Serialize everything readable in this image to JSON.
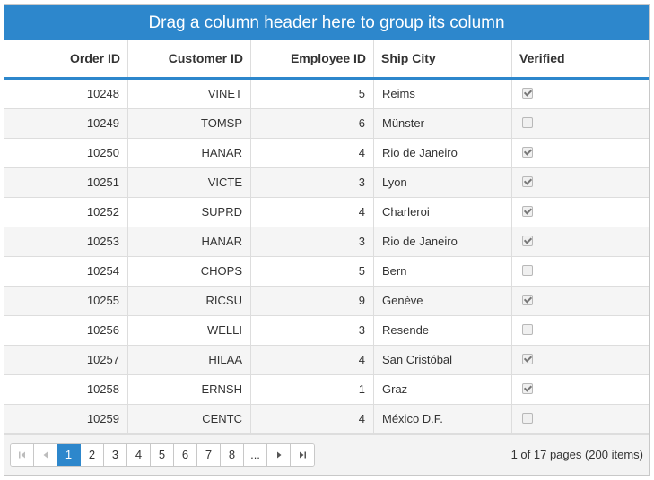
{
  "group_panel": {
    "text": "Drag a column header here to group its column"
  },
  "columns": [
    {
      "label": "Order ID",
      "align": "right"
    },
    {
      "label": "Customer ID",
      "align": "right"
    },
    {
      "label": "Employee ID",
      "align": "right"
    },
    {
      "label": "Ship City",
      "align": "left"
    },
    {
      "label": "Verified",
      "align": "left"
    }
  ],
  "rows": [
    {
      "order_id": "10248",
      "customer_id": "VINET",
      "employee_id": "5",
      "ship_city": "Reims",
      "verified": true
    },
    {
      "order_id": "10249",
      "customer_id": "TOMSP",
      "employee_id": "6",
      "ship_city": "Münster",
      "verified": false
    },
    {
      "order_id": "10250",
      "customer_id": "HANAR",
      "employee_id": "4",
      "ship_city": "Rio de Janeiro",
      "verified": true
    },
    {
      "order_id": "10251",
      "customer_id": "VICTE",
      "employee_id": "3",
      "ship_city": "Lyon",
      "verified": true
    },
    {
      "order_id": "10252",
      "customer_id": "SUPRD",
      "employee_id": "4",
      "ship_city": "Charleroi",
      "verified": true
    },
    {
      "order_id": "10253",
      "customer_id": "HANAR",
      "employee_id": "3",
      "ship_city": "Rio de Janeiro",
      "verified": true
    },
    {
      "order_id": "10254",
      "customer_id": "CHOPS",
      "employee_id": "5",
      "ship_city": "Bern",
      "verified": false
    },
    {
      "order_id": "10255",
      "customer_id": "RICSU",
      "employee_id": "9",
      "ship_city": "Genève",
      "verified": true
    },
    {
      "order_id": "10256",
      "customer_id": "WELLI",
      "employee_id": "3",
      "ship_city": "Resende",
      "verified": false
    },
    {
      "order_id": "10257",
      "customer_id": "HILAA",
      "employee_id": "4",
      "ship_city": "San Cristóbal",
      "verified": true
    },
    {
      "order_id": "10258",
      "customer_id": "ERNSH",
      "employee_id": "1",
      "ship_city": "Graz",
      "verified": true
    },
    {
      "order_id": "10259",
      "customer_id": "CENTC",
      "employee_id": "4",
      "ship_city": "México D.F.",
      "verified": false
    }
  ],
  "pager": {
    "pages": [
      "1",
      "2",
      "3",
      "4",
      "5",
      "6",
      "7",
      "8",
      "..."
    ],
    "current_page": "1",
    "info": "1 of 17 pages (200 items)",
    "icons": {
      "first": "first-page-icon",
      "prev": "previous-page-icon",
      "next": "next-page-icon",
      "last": "last-page-icon"
    }
  },
  "colors": {
    "accent": "#2d87cc",
    "alt_row": "#f5f5f5",
    "border": "#dddddd"
  }
}
